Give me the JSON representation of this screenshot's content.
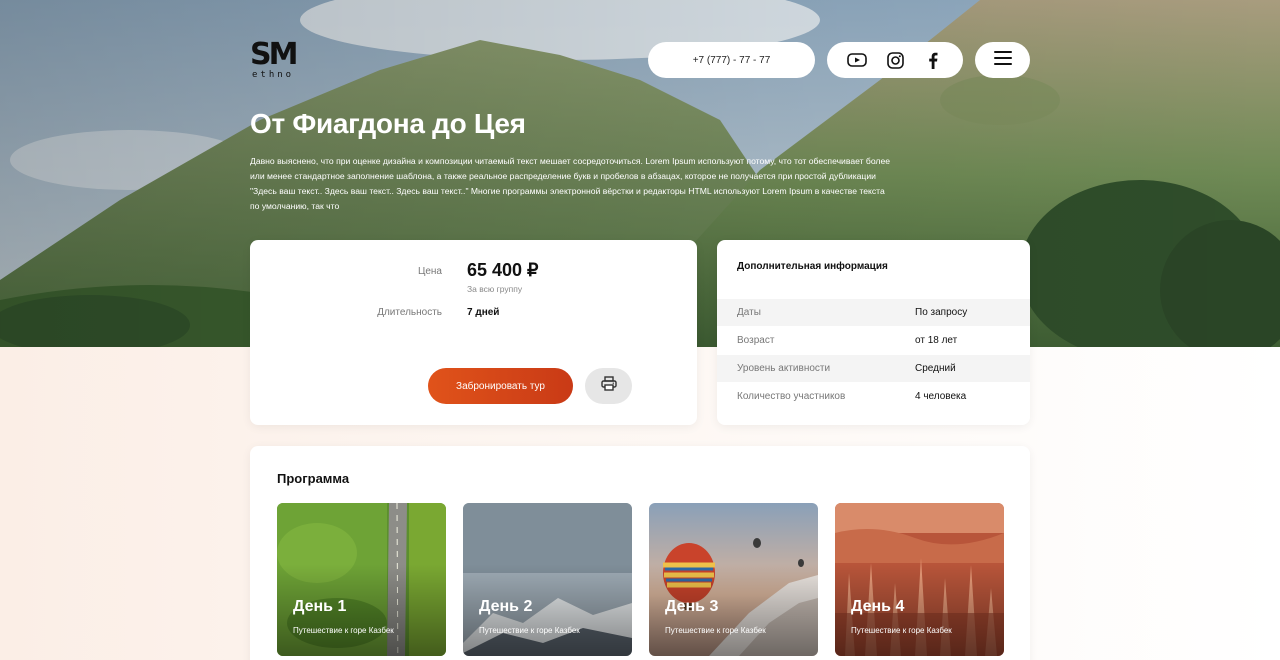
{
  "header": {
    "logo_main": "SM",
    "logo_sub": "ethno",
    "phone": "+7 (777) - 77 - 77",
    "social": [
      "youtube-icon",
      "instagram-icon",
      "facebook-icon"
    ],
    "menu_icon": "hamburger-menu-icon"
  },
  "hero": {
    "title": "От Фиагдона до Цея",
    "description": "Давно выяснено, что при оценке дизайна и композиции читаемый текст мешает сосредоточиться. Lorem Ipsum используют потому, что тот обеспечивает более или менее стандартное заполнение шаблона, а также реальное распределение букв и пробелов в абзацах, которое не получается при простой дубликации \"Здесь ваш текст.. Здесь ваш текст.. Здесь ваш текст..\" Многие программы электронной вёрстки и редакторы HTML используют Lorem Ipsum в качестве текста по умолчанию, так что"
  },
  "tour": {
    "price_label": "Цена",
    "price_value": "65 400 ₽",
    "price_note": "За всю группу",
    "duration_label": "Длительность",
    "duration_value": "7 дней",
    "book_label": "Забронировать тур",
    "print_icon": "printer-icon"
  },
  "info": {
    "title": "Дополнительная информация",
    "rows": [
      {
        "key": "Даты",
        "value": "По запросу"
      },
      {
        "key": "Возраст",
        "value": "от 18 лет"
      },
      {
        "key": "Уровень активности",
        "value": "Средний"
      },
      {
        "key": "Количество участников",
        "value": "4 человека"
      }
    ]
  },
  "program": {
    "title": "Программа",
    "days": [
      {
        "title": "День 1",
        "subtitle": "Путешествие к горе Казбек"
      },
      {
        "title": "День 2",
        "subtitle": "Путешествие к горе Казбек"
      },
      {
        "title": "День 3",
        "subtitle": "Путешествие к горе Казбек"
      },
      {
        "title": "День 4",
        "subtitle": "Путешествие к горе Казбек"
      }
    ]
  },
  "colors": {
    "accent": "#d9481a",
    "card_bg": "#ffffff",
    "muted_text": "#777777"
  }
}
